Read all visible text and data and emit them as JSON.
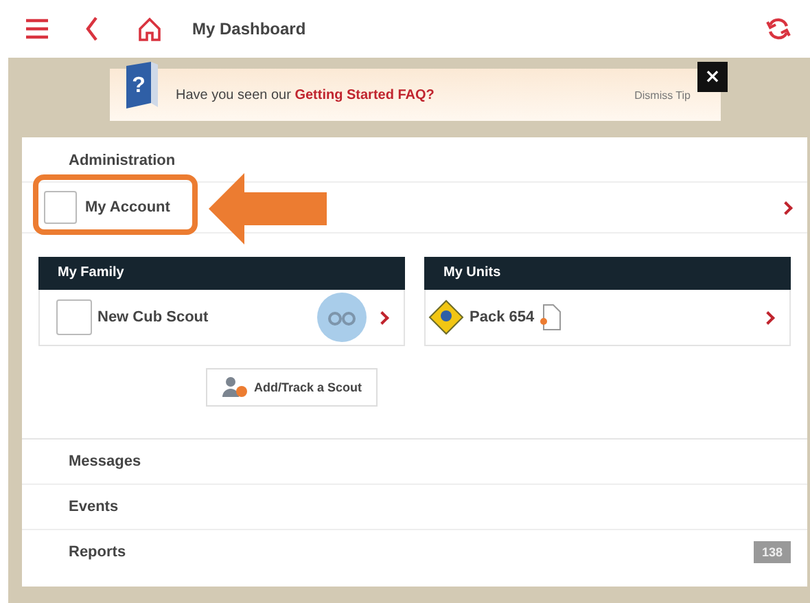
{
  "header": {
    "title": "My Dashboard"
  },
  "tip": {
    "icon": "?",
    "text": "Have you seen our",
    "link": "Getting Started FAQ?",
    "dismiss": "Dismiss Tip",
    "close": "×"
  },
  "administration": {
    "heading": "Administration",
    "items": [
      {
        "label": "My Account",
        "highlighted": true
      }
    ]
  },
  "cards": [
    {
      "title": "My Family",
      "items": [
        {
          "label": "New Cub Scout",
          "kind": "person"
        }
      ]
    },
    {
      "title": "My Units",
      "items": [
        {
          "label": "Pack 654",
          "kind": "unit"
        }
      ]
    }
  ],
  "add_button": "Add/Track a Scout",
  "menu": [
    {
      "label": "Messages"
    },
    {
      "label": "Events"
    },
    {
      "label": "Reports",
      "badge": "138"
    }
  ]
}
